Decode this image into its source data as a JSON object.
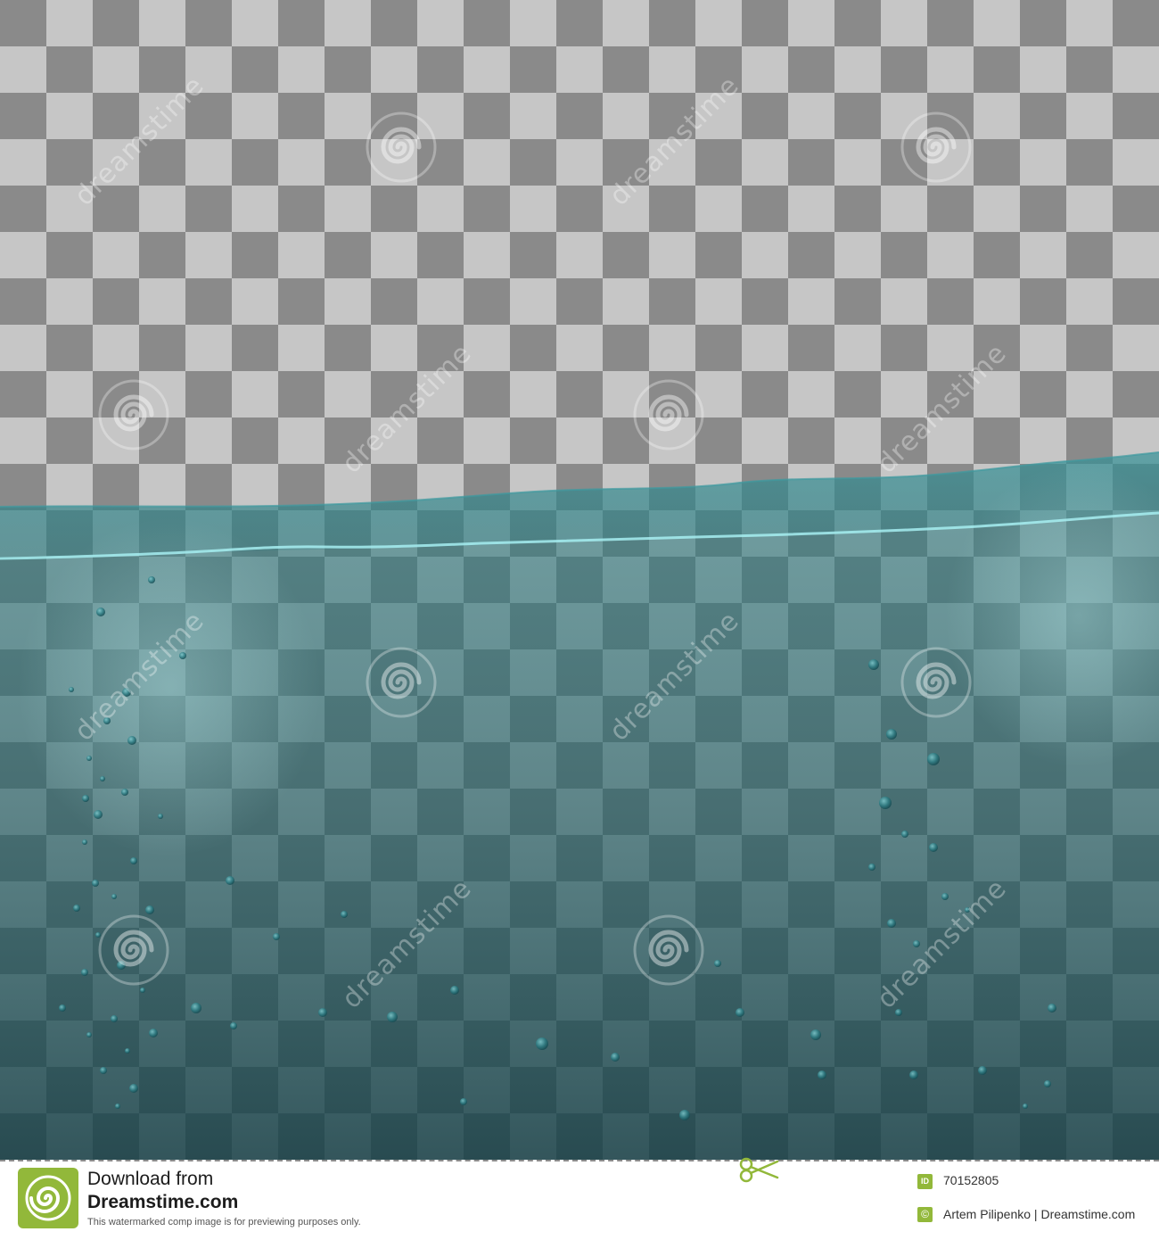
{
  "image": {
    "description": "Stock vector illustration: turquoise water surface with wave line and air bubbles over a gray transparency checkerboard",
    "checker_light": "#c6c6c6",
    "checker_dark": "#8a8a8a",
    "water_color": "#1f5d62",
    "surface_highlight": "#9fe8ec"
  },
  "watermark": {
    "text": "dreamstime",
    "logo_icon": "dreamstime-spiral-icon"
  },
  "footer": {
    "download_line1": "Download from",
    "download_line2": "Dreamstime.com",
    "preview_note": "This watermarked comp image is for previewing purposes only.",
    "id_label": "ID",
    "id_value": "70152805",
    "copyright_symbol": "©",
    "credit": "Artem Pilipenko | Dreamstime.com",
    "accent": "#92b83a",
    "scissors_icon": "scissors-icon"
  }
}
